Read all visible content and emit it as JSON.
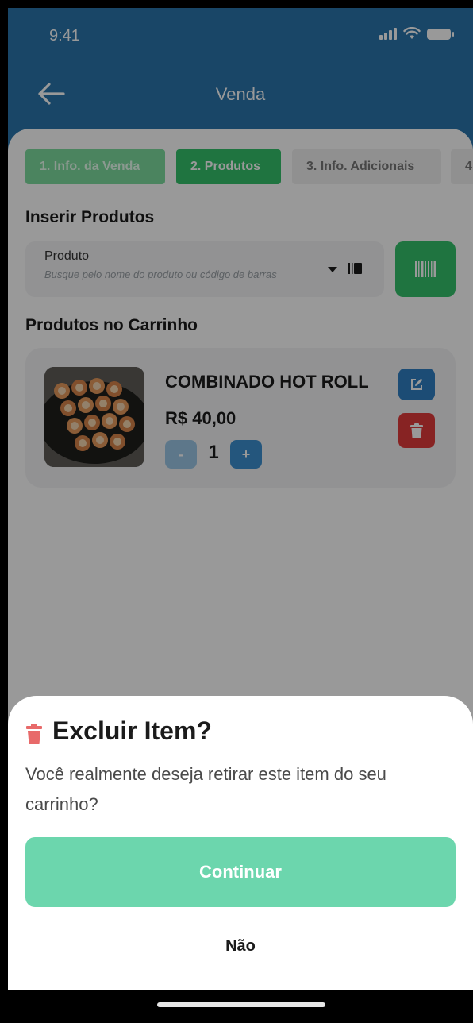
{
  "status_bar": {
    "time": "9:41"
  },
  "header": {
    "title": "Venda",
    "back_icon": "arrow-left-icon"
  },
  "steps": [
    {
      "label": "1. Info. da Venda",
      "state": "done"
    },
    {
      "label": "2. Produtos",
      "state": "active"
    },
    {
      "label": "3. Info. Adicionais",
      "state": "pending"
    },
    {
      "label": "4",
      "state": "pending"
    }
  ],
  "insert_section": {
    "title": "Inserir Produtos",
    "product_field": {
      "label": "Produto",
      "placeholder": "Busque pelo nome do produto ou código de barras"
    }
  },
  "cart_section": {
    "title": "Produtos no Carrinho",
    "items": [
      {
        "name": "COMBINADO HOT ROLL",
        "price": "R$ 40,00",
        "quantity": "1",
        "minus_label": "-",
        "plus_label": "+"
      }
    ]
  },
  "dialog": {
    "title": "Excluir Item?",
    "message": "Você realmente deseja retirar este item do seu carrinho?",
    "confirm_label": "Continuar",
    "cancel_label": "Não"
  },
  "colors": {
    "header": "#2a76ac",
    "step_active": "#34c26b",
    "danger": "#e23b3b",
    "confirm": "#6cd6ad"
  }
}
